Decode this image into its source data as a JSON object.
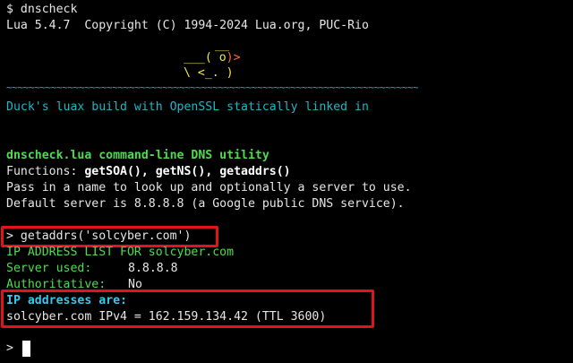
{
  "header": {
    "prompt_line": "$ dnscheck",
    "version_line": "Lua 5.4.7  Copyright (C) 1994-2024 Lua.org, PUC-Rio"
  },
  "logo": {
    "row1": "__",
    "row2_left": "___( o",
    "row2_right": ")>",
    "row3": "\\ <_. )",
    "wave": "~~~~~~~~~~~~~~~~~~~~~~~~~~~~~~~~~~~~~~~~~~~~~~~~~~~~~~~~~~~~~~~~~~~~~~~~~~~~~~~~~~~~"
  },
  "build_line": "Duck's luax build with OpenSSL statically linked in",
  "intro": {
    "title": "dnscheck.lua command-line DNS utility",
    "functions_label": "Functions: ",
    "functions": "getSOA(), getNS(), getaddrs()",
    "pass_line": "Pass in a name to look up and optionally a server to use.",
    "default_line": "Default server is 8.8.8.8 (a Google public DNS service)."
  },
  "session": {
    "command": "> getaddrs('solcyber.com')",
    "list_header": "IP ADDRESS LIST FOR solcyber.com",
    "server_label": "Server used:",
    "server_value": "8.8.8.8",
    "auth_label": "Authoritative:",
    "auth_value": "No",
    "addresses_label": "IP addresses are:",
    "address_line": "solcyber.com IPv4 = 162.159.134.42 (TTL 3600)",
    "next_prompt": ">"
  },
  "colors": {
    "highlight_box": "#e0141b",
    "logo_cyan": "#22b5c4",
    "logo_yellow": "#f1e84a",
    "logo_orange": "#ff6b30",
    "output_green": "#4fdb4f",
    "background": "#000000"
  }
}
